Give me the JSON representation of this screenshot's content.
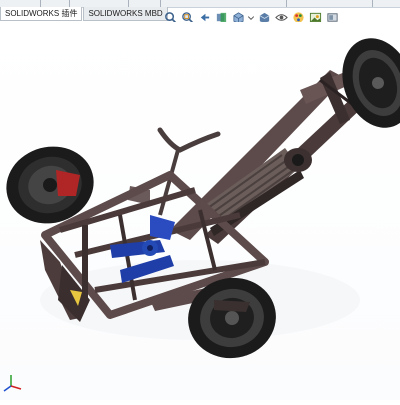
{
  "toolbar": {
    "tabs": [
      {
        "label": "SOLIDWORKS 插件",
        "active": true
      },
      {
        "label": "SOLIDWORKS MBD",
        "active": false
      }
    ]
  },
  "heads_up_view_toolbar": {
    "icons": [
      "zoom-to-fit-icon",
      "zoom-to-area-icon",
      "previous-view-icon",
      "section-view-icon",
      "view-orientation-icon",
      "display-style-icon",
      "hide-show-items-icon",
      "edit-appearance-icon",
      "apply-scene-icon",
      "view-settings-icon"
    ]
  },
  "model": {
    "name": "three-wheel-chassis",
    "colors": {
      "frame": "#5d4a4a",
      "frame_dark": "#2b2323",
      "tire": "#1b1b1b",
      "rim": "#3d3d3d",
      "suspension_blue": "#1f3ea8",
      "spring_red": "#b02626",
      "radiator": "#6a5d5a"
    }
  },
  "colors": {
    "background": "#ffffff",
    "accent": "#3a6ea5"
  }
}
